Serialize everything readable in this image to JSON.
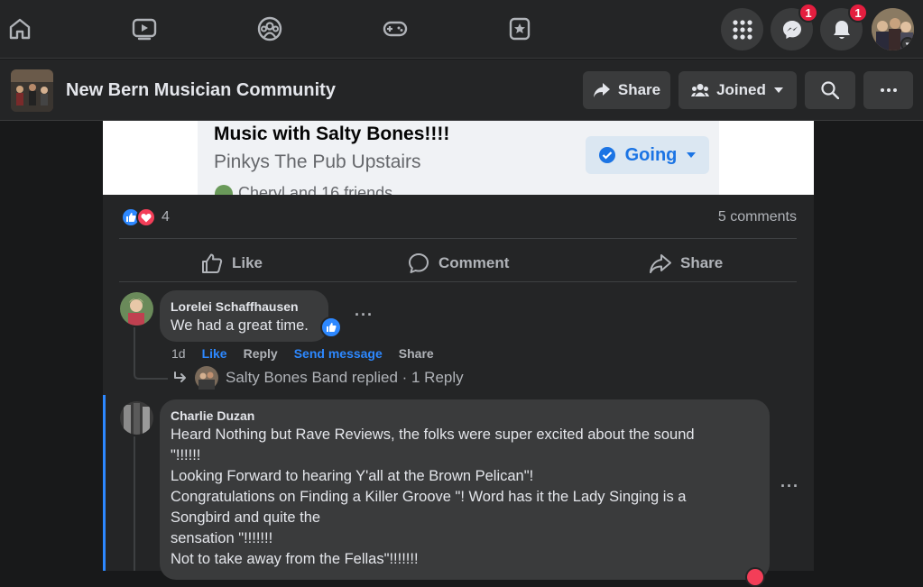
{
  "topbar": {
    "nav": [
      "home-icon",
      "watch-icon",
      "groups-icon",
      "gaming-icon",
      "favorites-icon"
    ],
    "messenger_badge": "1",
    "notifications_badge": "1"
  },
  "group": {
    "title": "New Bern Musician Community",
    "share_label": "Share",
    "joined_label": "Joined"
  },
  "event": {
    "title": "Music with Salty Bones!!!!",
    "location": "Pinkys The Pub Upstairs",
    "friends": "Cheryl and 16 friends",
    "going_label": "Going"
  },
  "post": {
    "reaction_count": "4",
    "comments_count": "5 comments",
    "actions": {
      "like": "Like",
      "comment": "Comment",
      "share": "Share"
    }
  },
  "comments": [
    {
      "author": "Lorelei Schaffhausen",
      "text": "We had a great time.",
      "time": "1d",
      "like": "Like",
      "reply": "Reply",
      "send_message": "Send message",
      "share": "Share",
      "replies_summary": "Salty Bones Band replied · 1 Reply"
    },
    {
      "author": "Charlie Duzan",
      "lines": [
        "Heard Nothing but Rave Reviews, the folks were super excited about the sound",
        "\"!!!!!!",
        "Looking Forward to hearing Y'all at the Brown Pelican\"!",
        "Congratulations on Finding a Killer Groove \"! Word has it the Lady Singing is a",
        "Songbird and quite the",
        "sensation \"!!!!!!!",
        "Not to take away from the Fellas\"!!!!!!!"
      ]
    }
  ],
  "colors": {
    "background": "#18191a",
    "surface": "#242526",
    "bubble": "#3a3b3c",
    "accent": "#2d88ff",
    "badge": "#e41e3f",
    "heart": "#f33e58"
  }
}
